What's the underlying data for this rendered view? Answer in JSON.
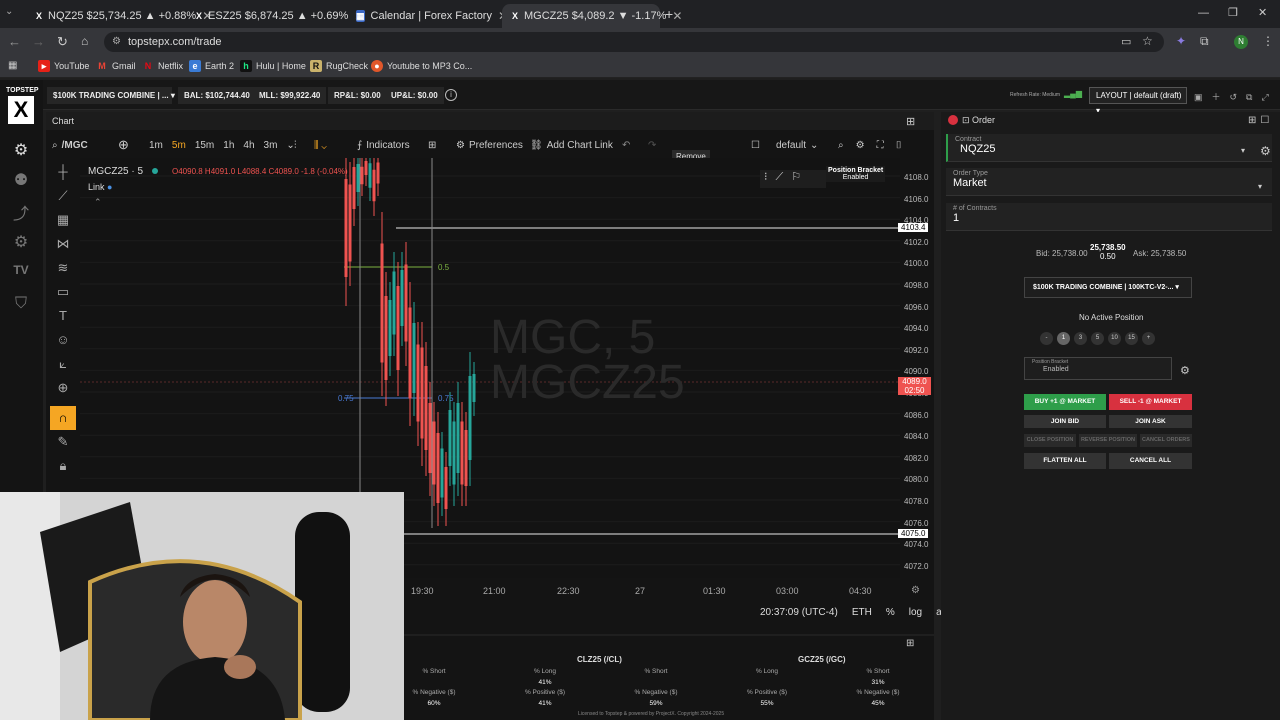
{
  "browser": {
    "tabs": [
      {
        "label": "NQZ25 $25,734.25 ▲ +0.88%",
        "icon": "topstep-x-icon"
      },
      {
        "label": "ESZ25 $6,874.25 ▲ +0.69%",
        "icon": "topstep-x-icon"
      },
      {
        "label": "Calendar | Forex Factory",
        "icon": "forexfactory-icon"
      },
      {
        "label": "MGCZ25 $4,089.2 ▼ -1.17%",
        "icon": "topstep-x-icon"
      }
    ],
    "url": "topstepx.com/trade",
    "bookmarks": [
      "YouTube",
      "Gmail",
      "Netflix",
      "Earth 2",
      "Hulu | Home",
      "RugCheck",
      "Youtube to MP3 Co..."
    ],
    "profile_initial": "N"
  },
  "header": {
    "logo": "TOPSTEP",
    "account": "$100K TRADING COMBINE | ...",
    "bal": "BAL: $102,744.40",
    "mll": "MLL: $99,922.40",
    "rpl": "RP&L: $0.00",
    "upl": "UP&L: $0.00",
    "refresh": "Refresh Rate: Medium",
    "layout": "LAYOUT | default (draft)"
  },
  "chart": {
    "panel_title": "Chart",
    "symbol": "/MGC",
    "intervals": [
      "1m",
      "5m",
      "15m",
      "1h",
      "4h",
      "3m"
    ],
    "active_interval": "5m",
    "indicators": "Indicators",
    "preferences": "Preferences",
    "add_link": "Add Chart Link",
    "template": "default",
    "remove": "Remove",
    "legend_symbol": "MGCZ25 · 5",
    "ohlc": "O4090.8  H4091.0  L4088.4  C4089.0  -1.8 (-0.04%)",
    "link": "Link",
    "bracket_title": "Position Bracket",
    "bracket_state": "Enabled",
    "watermark_1": "MGC, 5",
    "watermark_2": "MGCZ25",
    "fib_05": "0.5",
    "fib_075": "0.75",
    "price_line_upper": "4103.4",
    "price_line_lower": "4075.0",
    "last_price": "4089.0",
    "countdown": "02:50",
    "y_ticks": [
      "4108.0",
      "4106.0",
      "4104.0",
      "4102.0",
      "4100.0",
      "4098.0",
      "4096.0",
      "4094.0",
      "4092.0",
      "4090.0",
      "4088.0",
      "4086.0",
      "4084.0",
      "4082.0",
      "4080.0",
      "4078.0",
      "4076.0",
      "4074.0",
      "4072.0"
    ],
    "x_ticks": [
      "19:30",
      "21:00",
      "22:30",
      "27",
      "01:30",
      "03:00",
      "04:30"
    ],
    "time": "20:37:09 (UTC-4)",
    "session": "ETH",
    "pct": "%",
    "log": "log",
    "auto": "auto"
  },
  "order": {
    "title": "Order",
    "contract_label": "Contract",
    "contract": "NQZ25",
    "type_label": "Order Type",
    "type": "Market",
    "contracts_label": "# of Contracts",
    "contracts": "1",
    "bid": "Bid: 25,738.00",
    "last": "25,738.50",
    "spread": "0.50",
    "ask": "Ask: 25,738.50",
    "account": "$100K TRADING COMBINE | 100KTC-V2-...",
    "position": "No Active Position",
    "qty_buttons": [
      "-",
      "1",
      "3",
      "5",
      "10",
      "15",
      "+"
    ],
    "bracket_label": "Position Bracket",
    "bracket": "Enabled",
    "buy": "BUY +1 @ MARKET",
    "sell": "SELL -1 @ MARKET",
    "join_bid": "JOIN BID",
    "join_ask": "JOIN ASK",
    "close": "CLOSE POSITION",
    "reverse": "REVERSE POSITION",
    "cancel_orders": "CANCEL ORDERS",
    "flatten": "FLATTEN ALL",
    "cancel_all": "CANCEL ALL"
  },
  "sentiment": {
    "cl_title": "CLZ25 (/CL)",
    "gc_title": "GCZ25 (/GC)",
    "cols": [
      {
        "l1": "% Short",
        "v1": "",
        "l2": "% Negative ($)",
        "v2": "60%"
      },
      {
        "l1": "% Long",
        "v1": "41%",
        "l2": "% Positive ($)",
        "v2": "41%"
      },
      {
        "l1": "% Short",
        "v1": "",
        "l2": "% Negative ($)",
        "v2": "59%"
      },
      {
        "l1": "% Long",
        "v1": "",
        "l2": "% Positive ($)",
        "v2": "55%"
      },
      {
        "l1": "% Short",
        "v1": "31%",
        "l2": "% Negative ($)",
        "v2": "45%"
      }
    ],
    "footer": "Licensed to Topstep & powered by ProjectX. Copyright 2024-2025"
  },
  "colors": {
    "buy": "#2e9e4a",
    "sell": "#d8313f",
    "up": "#26a69a",
    "down": "#ef5350",
    "accent": "#f5a623"
  }
}
